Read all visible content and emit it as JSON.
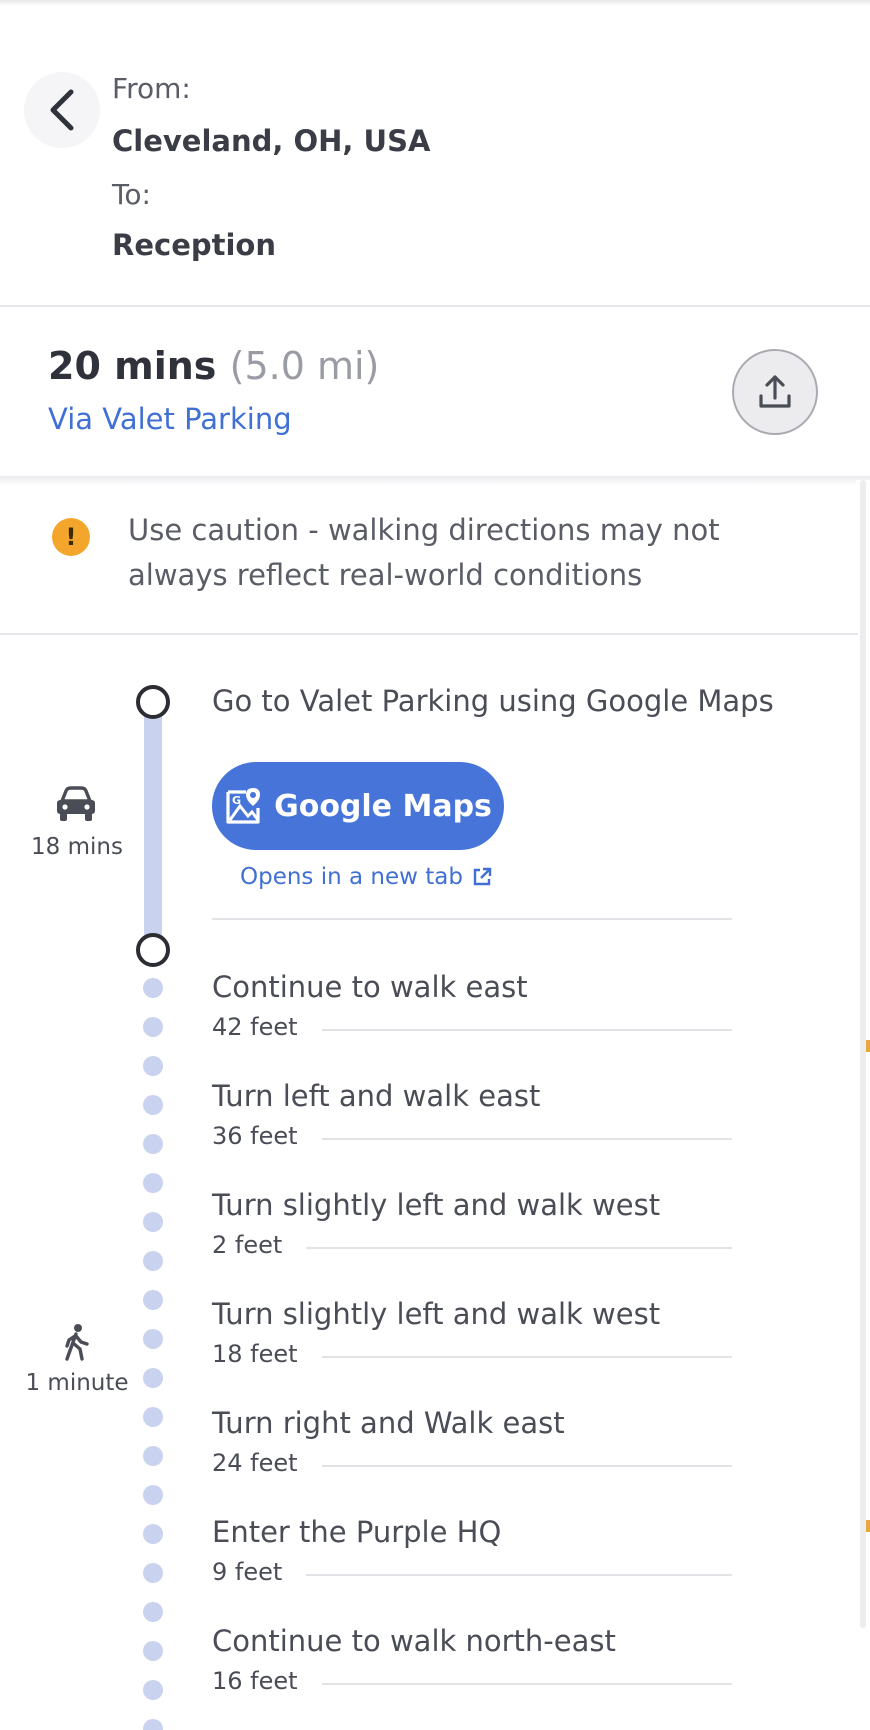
{
  "header": {
    "from_label": "From:",
    "from_value": "Cleveland, OH, USA",
    "to_label": "To:",
    "to_value": "Reception"
  },
  "summary": {
    "duration": "20 mins",
    "distance": "(5.0 mi)",
    "via": "Via Valet Parking"
  },
  "warning": {
    "icon": "!",
    "text": "Use caution - walking directions may not always reflect real-world conditions"
  },
  "drive_leg": {
    "mode_icon": "car-icon",
    "duration": "18 mins",
    "instruction": "Go to Valet Parking using Google Maps",
    "button_label": "Google Maps",
    "new_tab_note": "Opens in a new tab"
  },
  "walk_leg": {
    "mode_icon": "walk-icon",
    "duration": "1 minute",
    "steps": [
      {
        "title": "Continue to walk east",
        "distance": "42 feet"
      },
      {
        "title": "Turn left and walk east",
        "distance": "36 feet"
      },
      {
        "title": "Turn slightly left and walk west",
        "distance": "2 feet"
      },
      {
        "title": "Turn slightly left and walk west",
        "distance": "18 feet"
      },
      {
        "title": "Turn right and Walk east",
        "distance": "24 feet"
      },
      {
        "title": "Enter the Purple HQ",
        "distance": "9 feet"
      },
      {
        "title": "Continue to walk north-east",
        "distance": "16 feet"
      }
    ]
  },
  "colors": {
    "accent": "#4674d9",
    "link": "#4170d4",
    "warning": "#f4a52b",
    "timeline": "#c9d3f0"
  }
}
